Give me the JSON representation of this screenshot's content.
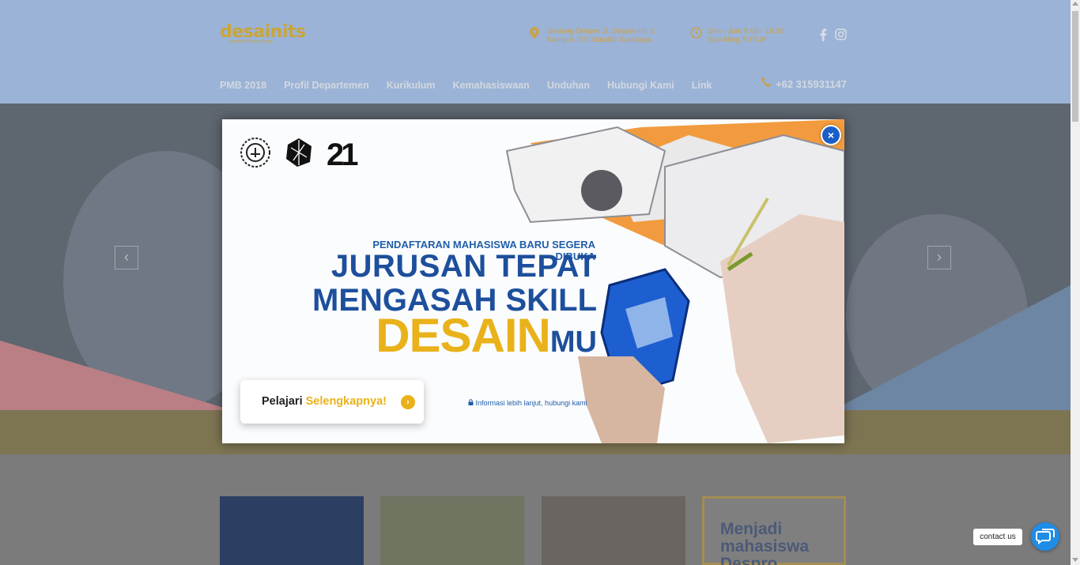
{
  "header": {
    "logo_text": "desainits",
    "logo_sub": "Industrial Product Design",
    "address_line1": "Gedung Despro Jl. Despro no. 1",
    "address_line2": "Kampus ITS Sukolilo Surabaya.",
    "hours_line1": "Sen - Jum 8.00 - 16.00",
    "hours_line2": "Sab-Ming TUTUP",
    "phone": "+62 315931147",
    "nav": [
      "PMB 2018",
      "Profil Departemen",
      "Kurikulum",
      "Kemahasiswaan",
      "Unduhan",
      "Hubungi Kami",
      "Link"
    ]
  },
  "hero": {
    "prev_label": "‹",
    "next_label": "›"
  },
  "content": {
    "side_card_text": "Menjadi mahasiswa Despro"
  },
  "modal": {
    "logo_21": "21",
    "subtitle": "PENDAFTARAN MAHASISWA BARU SEGERA DIBUKA",
    "headline1": "JURUSAN TEPAT",
    "headline2": "MENGASAH SKILL",
    "headline3a": "DESAIN",
    "headline3b": "MU",
    "button_a": "Pelajari",
    "button_b": "Selengkapnya!",
    "info": "Informasi lebih lanjut, hubungi kami",
    "close_label": "×"
  },
  "contact": {
    "label": "contact us"
  },
  "colors": {
    "header_bg": "#9bb3d6",
    "accent_gold": "#e9b21a",
    "brand_blue": "#1d4f9c",
    "close_blue": "#1a5fc7"
  }
}
